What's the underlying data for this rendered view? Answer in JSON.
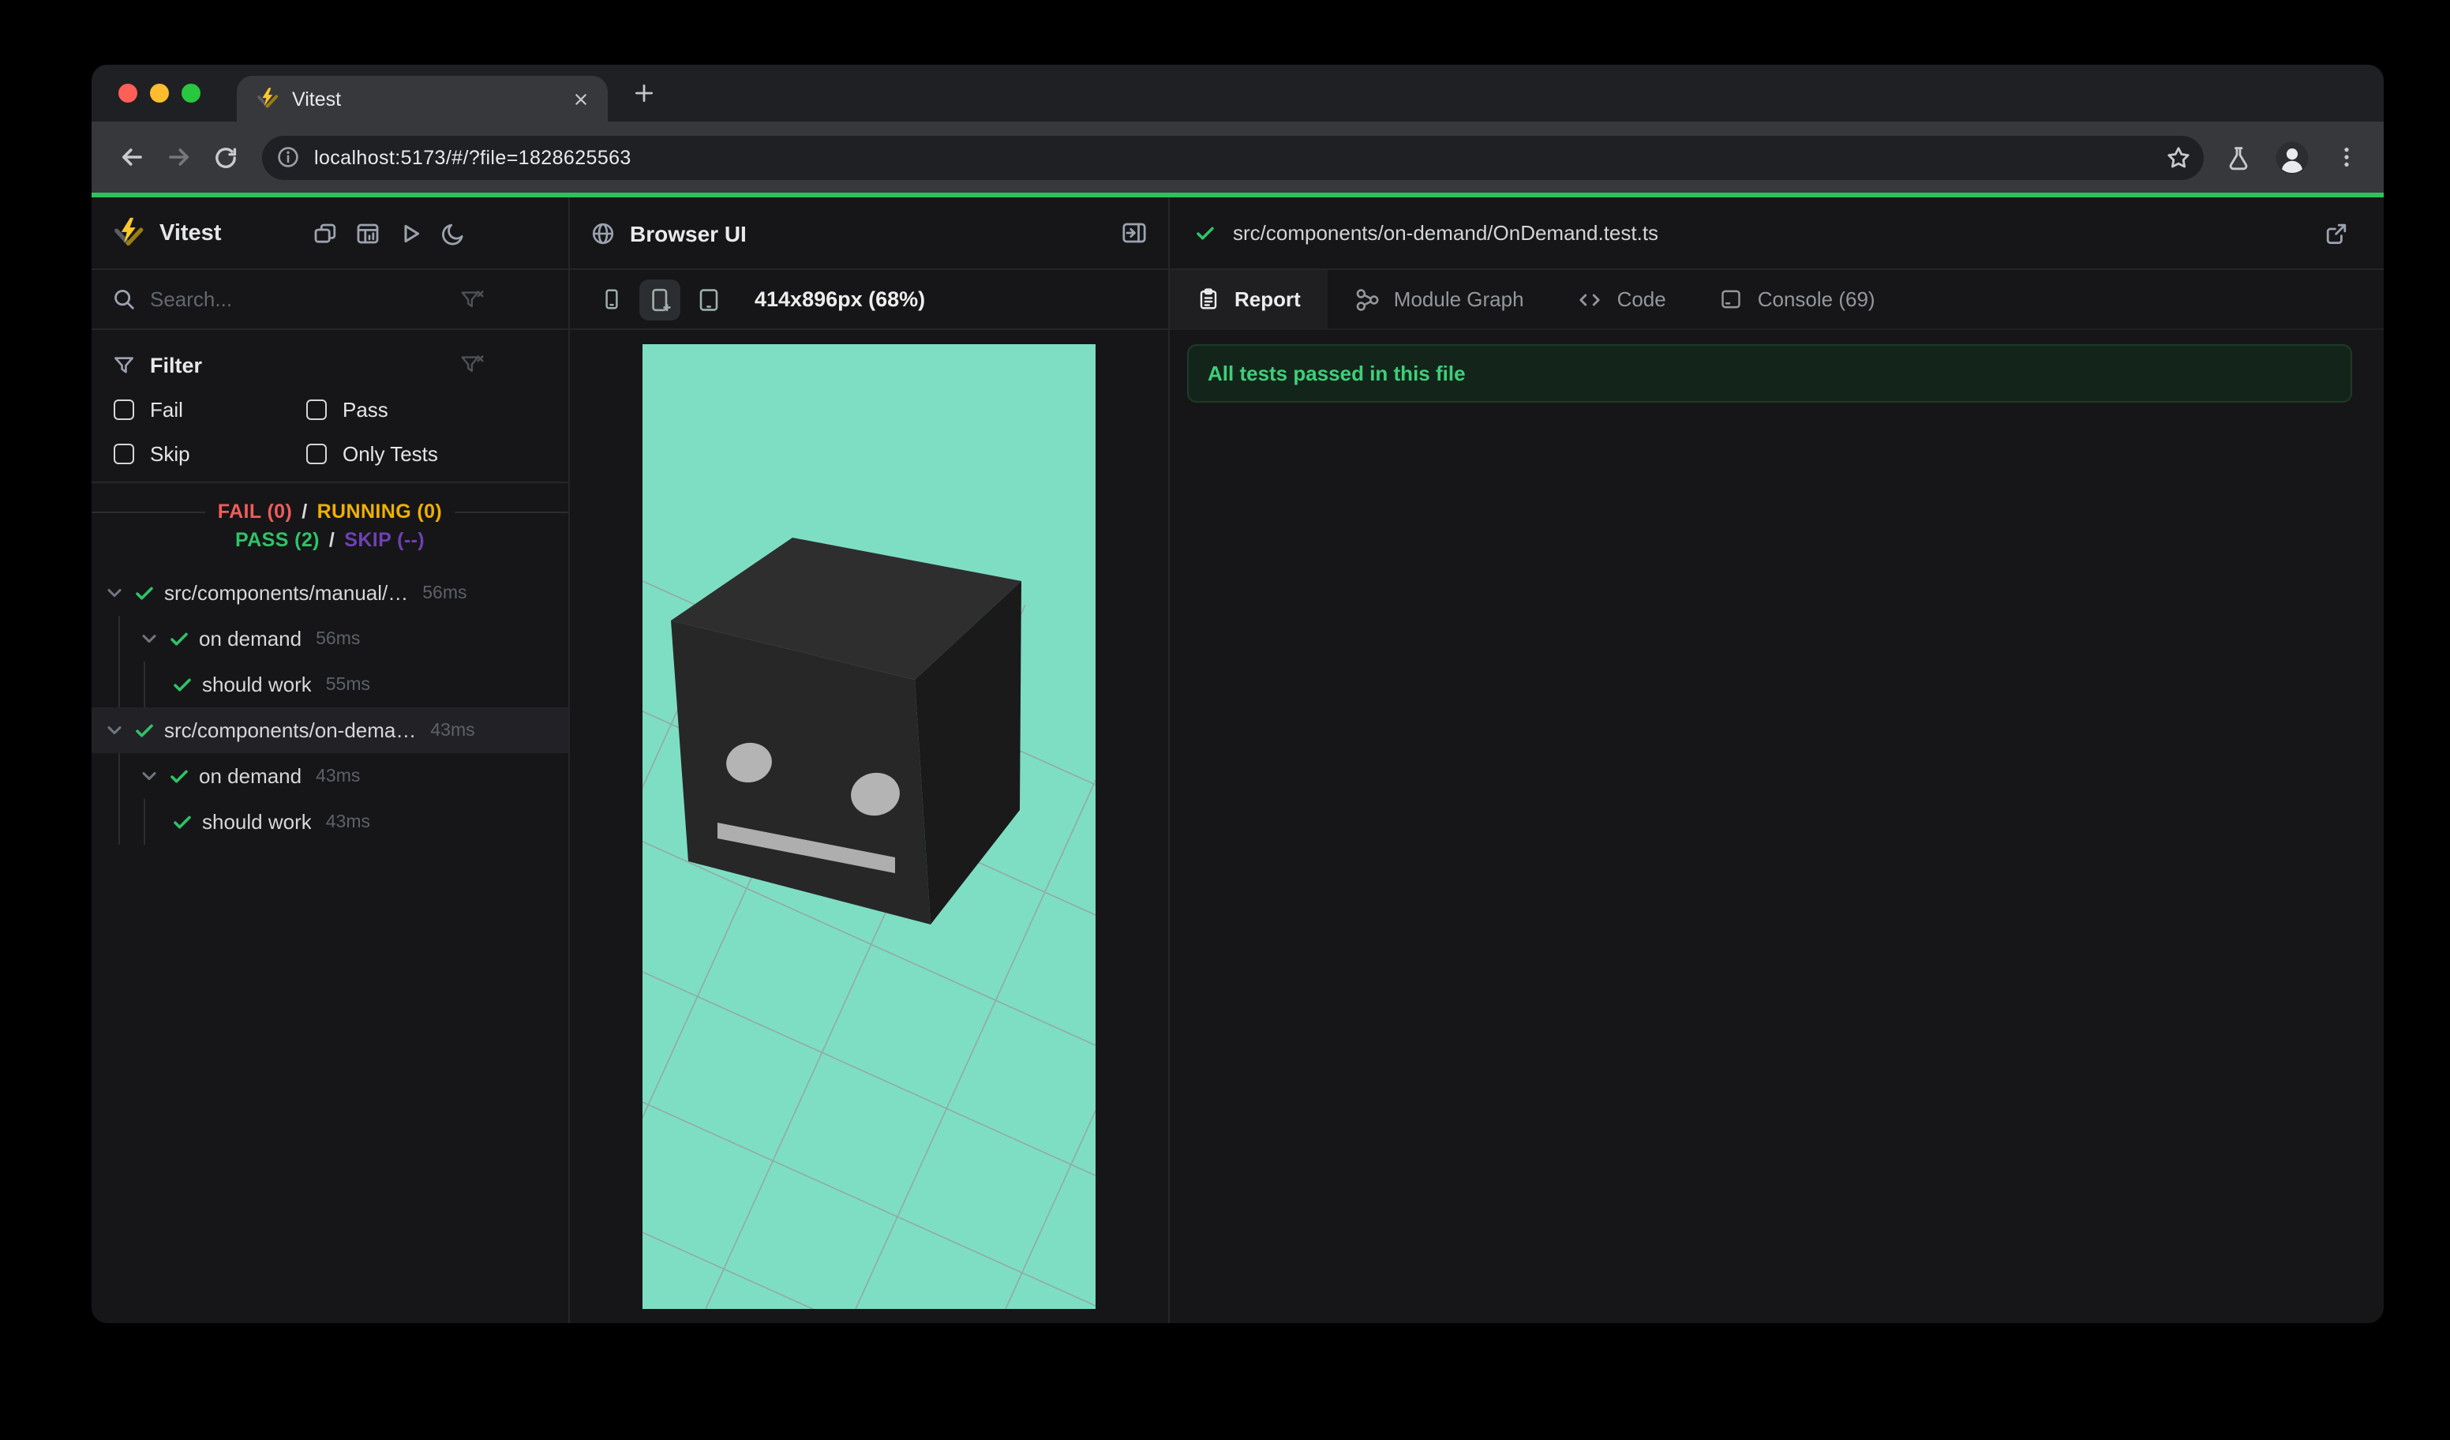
{
  "window": {
    "tab_title": "Vitest",
    "url": "localhost:5173/#/?file=1828625563"
  },
  "sidebar": {
    "title": "Vitest",
    "search_placeholder": "Search...",
    "filter": {
      "title": "Filter",
      "options": [
        {
          "label": "Fail",
          "checked": false
        },
        {
          "label": "Pass",
          "checked": false
        },
        {
          "label": "Skip",
          "checked": false
        },
        {
          "label": "Only Tests",
          "checked": false
        }
      ]
    },
    "stats": {
      "fail": "FAIL (0)",
      "running": "RUNNING (0)",
      "pass": "PASS (2)",
      "skip": "SKIP (--)",
      "separator": "/"
    },
    "tree": [
      {
        "label": "src/components/manual/…",
        "time": "56ms",
        "depth": 0,
        "status": "pass",
        "selected": false
      },
      {
        "label": "on demand",
        "time": "56ms",
        "depth": 1,
        "status": "pass",
        "selected": false
      },
      {
        "label": "should work",
        "time": "55ms",
        "depth": 2,
        "status": "pass",
        "selected": false
      },
      {
        "label": "src/components/on-dema…",
        "time": "43ms",
        "depth": 0,
        "status": "pass",
        "selected": true
      },
      {
        "label": "on demand",
        "time": "43ms",
        "depth": 1,
        "status": "pass",
        "selected": false
      },
      {
        "label": "should work",
        "time": "43ms",
        "depth": 2,
        "status": "pass",
        "selected": false
      }
    ]
  },
  "preview": {
    "title": "Browser UI",
    "viewport_label": "414x896px (68%)"
  },
  "report": {
    "file": "src/components/on-demand/OnDemand.test.ts",
    "tabs": [
      {
        "label": "Report",
        "active": true
      },
      {
        "label": "Module Graph",
        "active": false
      },
      {
        "label": "Code",
        "active": false
      },
      {
        "label": "Console (69)",
        "active": false
      }
    ],
    "banner": "All tests passed in this file"
  },
  "colors": {
    "progress_green": "#2bc45a",
    "pass_green": "#2fc368",
    "fail_red": "#f15c5c",
    "running_amber": "#efb100",
    "skip_purple": "#6e41b4",
    "banner_text_green": "#3ecf79",
    "mint_background": "#7edec3",
    "vitest_yellow": "#fcc72b",
    "toolbar_gray": "#37383c",
    "app_background": "#161618"
  },
  "icons": {
    "traffic": [
      "close",
      "minimize",
      "zoom"
    ],
    "toolbar": [
      "back-arrow",
      "forward-arrow",
      "reload",
      "info",
      "bookmark-star",
      "flask",
      "profile",
      "menu-kebab"
    ],
    "sidebar_header": [
      "vitest-logo",
      "panels",
      "dashboard",
      "run-all",
      "dark-mode-moon"
    ],
    "sidebar_rows": [
      "search-magnifier",
      "filter-clear-funnel-x",
      "filter-funnel",
      "chevron-down",
      "check"
    ],
    "middle": [
      "globe",
      "panel-right",
      "phone-small",
      "phone-plus",
      "tablet"
    ],
    "right": [
      "check",
      "external-link",
      "report-clipboard",
      "module-graph-nodes",
      "code-brackets",
      "console-panel"
    ]
  }
}
